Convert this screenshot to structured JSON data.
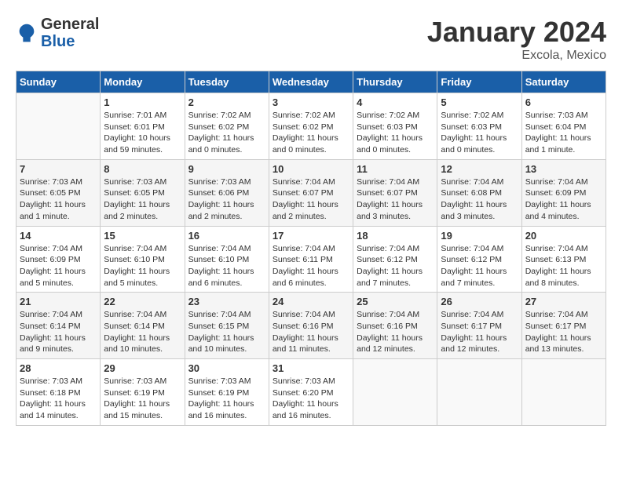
{
  "header": {
    "logo_general": "General",
    "logo_blue": "Blue",
    "month": "January 2024",
    "location": "Excola, Mexico"
  },
  "weekdays": [
    "Sunday",
    "Monday",
    "Tuesday",
    "Wednesday",
    "Thursday",
    "Friday",
    "Saturday"
  ],
  "weeks": [
    [
      {
        "day": "",
        "empty": true
      },
      {
        "day": "1",
        "sunrise": "Sunrise: 7:01 AM",
        "sunset": "Sunset: 6:01 PM",
        "daylight": "Daylight: 10 hours and 59 minutes."
      },
      {
        "day": "2",
        "sunrise": "Sunrise: 7:02 AM",
        "sunset": "Sunset: 6:02 PM",
        "daylight": "Daylight: 11 hours and 0 minutes."
      },
      {
        "day": "3",
        "sunrise": "Sunrise: 7:02 AM",
        "sunset": "Sunset: 6:02 PM",
        "daylight": "Daylight: 11 hours and 0 minutes."
      },
      {
        "day": "4",
        "sunrise": "Sunrise: 7:02 AM",
        "sunset": "Sunset: 6:03 PM",
        "daylight": "Daylight: 11 hours and 0 minutes."
      },
      {
        "day": "5",
        "sunrise": "Sunrise: 7:02 AM",
        "sunset": "Sunset: 6:03 PM",
        "daylight": "Daylight: 11 hours and 0 minutes."
      },
      {
        "day": "6",
        "sunrise": "Sunrise: 7:03 AM",
        "sunset": "Sunset: 6:04 PM",
        "daylight": "Daylight: 11 hours and 1 minute."
      }
    ],
    [
      {
        "day": "7",
        "sunrise": "Sunrise: 7:03 AM",
        "sunset": "Sunset: 6:05 PM",
        "daylight": "Daylight: 11 hours and 1 minute."
      },
      {
        "day": "8",
        "sunrise": "Sunrise: 7:03 AM",
        "sunset": "Sunset: 6:05 PM",
        "daylight": "Daylight: 11 hours and 2 minutes."
      },
      {
        "day": "9",
        "sunrise": "Sunrise: 7:03 AM",
        "sunset": "Sunset: 6:06 PM",
        "daylight": "Daylight: 11 hours and 2 minutes."
      },
      {
        "day": "10",
        "sunrise": "Sunrise: 7:04 AM",
        "sunset": "Sunset: 6:07 PM",
        "daylight": "Daylight: 11 hours and 2 minutes."
      },
      {
        "day": "11",
        "sunrise": "Sunrise: 7:04 AM",
        "sunset": "Sunset: 6:07 PM",
        "daylight": "Daylight: 11 hours and 3 minutes."
      },
      {
        "day": "12",
        "sunrise": "Sunrise: 7:04 AM",
        "sunset": "Sunset: 6:08 PM",
        "daylight": "Daylight: 11 hours and 3 minutes."
      },
      {
        "day": "13",
        "sunrise": "Sunrise: 7:04 AM",
        "sunset": "Sunset: 6:09 PM",
        "daylight": "Daylight: 11 hours and 4 minutes."
      }
    ],
    [
      {
        "day": "14",
        "sunrise": "Sunrise: 7:04 AM",
        "sunset": "Sunset: 6:09 PM",
        "daylight": "Daylight: 11 hours and 5 minutes."
      },
      {
        "day": "15",
        "sunrise": "Sunrise: 7:04 AM",
        "sunset": "Sunset: 6:10 PM",
        "daylight": "Daylight: 11 hours and 5 minutes."
      },
      {
        "day": "16",
        "sunrise": "Sunrise: 7:04 AM",
        "sunset": "Sunset: 6:10 PM",
        "daylight": "Daylight: 11 hours and 6 minutes."
      },
      {
        "day": "17",
        "sunrise": "Sunrise: 7:04 AM",
        "sunset": "Sunset: 6:11 PM",
        "daylight": "Daylight: 11 hours and 6 minutes."
      },
      {
        "day": "18",
        "sunrise": "Sunrise: 7:04 AM",
        "sunset": "Sunset: 6:12 PM",
        "daylight": "Daylight: 11 hours and 7 minutes."
      },
      {
        "day": "19",
        "sunrise": "Sunrise: 7:04 AM",
        "sunset": "Sunset: 6:12 PM",
        "daylight": "Daylight: 11 hours and 7 minutes."
      },
      {
        "day": "20",
        "sunrise": "Sunrise: 7:04 AM",
        "sunset": "Sunset: 6:13 PM",
        "daylight": "Daylight: 11 hours and 8 minutes."
      }
    ],
    [
      {
        "day": "21",
        "sunrise": "Sunrise: 7:04 AM",
        "sunset": "Sunset: 6:14 PM",
        "daylight": "Daylight: 11 hours and 9 minutes."
      },
      {
        "day": "22",
        "sunrise": "Sunrise: 7:04 AM",
        "sunset": "Sunset: 6:14 PM",
        "daylight": "Daylight: 11 hours and 10 minutes."
      },
      {
        "day": "23",
        "sunrise": "Sunrise: 7:04 AM",
        "sunset": "Sunset: 6:15 PM",
        "daylight": "Daylight: 11 hours and 10 minutes."
      },
      {
        "day": "24",
        "sunrise": "Sunrise: 7:04 AM",
        "sunset": "Sunset: 6:16 PM",
        "daylight": "Daylight: 11 hours and 11 minutes."
      },
      {
        "day": "25",
        "sunrise": "Sunrise: 7:04 AM",
        "sunset": "Sunset: 6:16 PM",
        "daylight": "Daylight: 11 hours and 12 minutes."
      },
      {
        "day": "26",
        "sunrise": "Sunrise: 7:04 AM",
        "sunset": "Sunset: 6:17 PM",
        "daylight": "Daylight: 11 hours and 12 minutes."
      },
      {
        "day": "27",
        "sunrise": "Sunrise: 7:04 AM",
        "sunset": "Sunset: 6:17 PM",
        "daylight": "Daylight: 11 hours and 13 minutes."
      }
    ],
    [
      {
        "day": "28",
        "sunrise": "Sunrise: 7:03 AM",
        "sunset": "Sunset: 6:18 PM",
        "daylight": "Daylight: 11 hours and 14 minutes."
      },
      {
        "day": "29",
        "sunrise": "Sunrise: 7:03 AM",
        "sunset": "Sunset: 6:19 PM",
        "daylight": "Daylight: 11 hours and 15 minutes."
      },
      {
        "day": "30",
        "sunrise": "Sunrise: 7:03 AM",
        "sunset": "Sunset: 6:19 PM",
        "daylight": "Daylight: 11 hours and 16 minutes."
      },
      {
        "day": "31",
        "sunrise": "Sunrise: 7:03 AM",
        "sunset": "Sunset: 6:20 PM",
        "daylight": "Daylight: 11 hours and 16 minutes."
      },
      {
        "day": "",
        "empty": true
      },
      {
        "day": "",
        "empty": true
      },
      {
        "day": "",
        "empty": true
      }
    ]
  ]
}
